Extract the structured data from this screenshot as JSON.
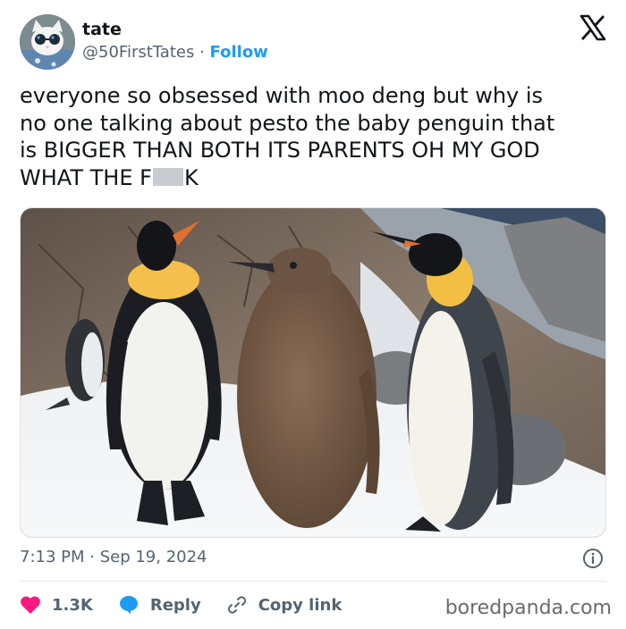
{
  "user": {
    "name": "tate",
    "handle": "@50FirstTates",
    "separator": "·",
    "follow_label": "Follow",
    "avatar_icon": "cat-with-sunglasses-avatar"
  },
  "brand_icon": "x-logo-icon",
  "tweet": {
    "text_part1": "everyone so obsessed with moo deng but why is\nno one talking about pesto the baby penguin that\nis BIGGER THAN BOTH ITS PARENTS OH MY GOD\nWHAT THE F",
    "text_part2": "K"
  },
  "media": {
    "description_icon": "photo-of-penguins"
  },
  "timestamp": "7:13 PM · Sep 19, 2024",
  "actions": {
    "like_count": "1.3K",
    "reply_label": "Reply",
    "copy_link_label": "Copy link"
  },
  "watermark": "boredpanda.com",
  "colors": {
    "accent": "#1d9bf0",
    "like": "#f91880",
    "text": "#0f1419",
    "muted": "#536471"
  }
}
